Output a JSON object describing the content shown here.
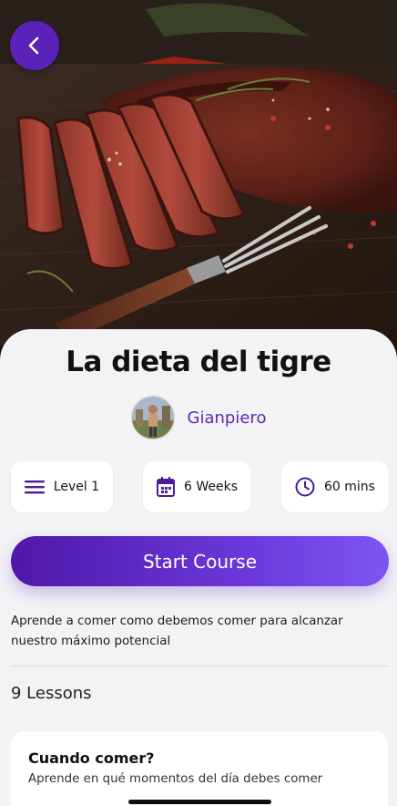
{
  "course": {
    "title": "La dieta del tigre",
    "author": "Gianpiero",
    "description": "Aprende a comer como debemos comer para alcanzar nuestro máximo potencial"
  },
  "meta": {
    "level": "Level 1",
    "duration": "6 Weeks",
    "time": "60 mins"
  },
  "actions": {
    "start_label": "Start Course"
  },
  "lessons": {
    "count_label": "9 Lessons",
    "items": [
      {
        "title": "Cuando comer?",
        "subtitle": "Aprende en qué momentos del día debes comer"
      }
    ]
  },
  "icons": {
    "back": "chevron-left-icon",
    "level": "menu-lines-icon",
    "duration": "calendar-icon",
    "time": "clock-icon"
  },
  "colors": {
    "accent": "#5b2bb8",
    "button_gradient_start": "#4f17a8",
    "button_gradient_end": "#7d55f3",
    "sheet_background": "#f3f2f5"
  }
}
